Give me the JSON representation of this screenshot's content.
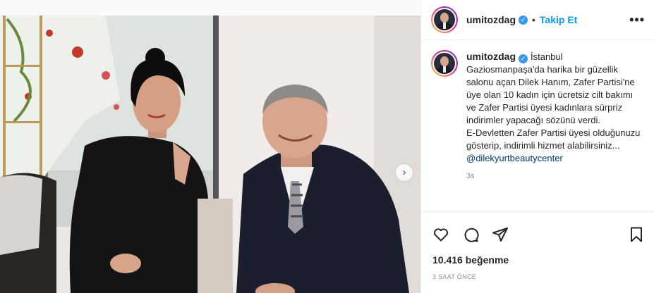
{
  "post": {
    "author": {
      "username": "umitozdag",
      "verified": true
    },
    "header": {
      "separator": "•",
      "follow_label": "Takip Et",
      "more_label": "•••"
    },
    "caption": {
      "location": "İstanbul",
      "text": "Gaziosmanpaşa'da harika bir güzellik salonu açan Dilek Hanım, Zafer Partisi'ne üye olan 10 kadın için ücretsiz cilt bakımı ve Zafer Partisi üyesi kadınlara sürpriz indirimler yapacağı sözünü verdi.\nE-Devletten Zafer Partisi üyesi olduğunuzu gösterip, indirimli hizmet alabilirsiniz...",
      "mention": "@dilekyurtbeautycenter",
      "age": "3s"
    },
    "stats": {
      "likes": "10.416 beğenme",
      "posted_ago": "3 SAAT ÖNCE"
    },
    "carousel": {
      "next_label": "›",
      "slide_count": 4,
      "active_index": 0
    },
    "icons": {
      "like": "heart-icon",
      "comment": "comment-icon",
      "share": "share-icon",
      "save": "bookmark-icon",
      "verified": "verified-badge-icon"
    },
    "colors": {
      "accent": "#0095f6",
      "verified": "#3897f0",
      "mention": "#00376b",
      "muted": "#8e8e8e"
    }
  }
}
